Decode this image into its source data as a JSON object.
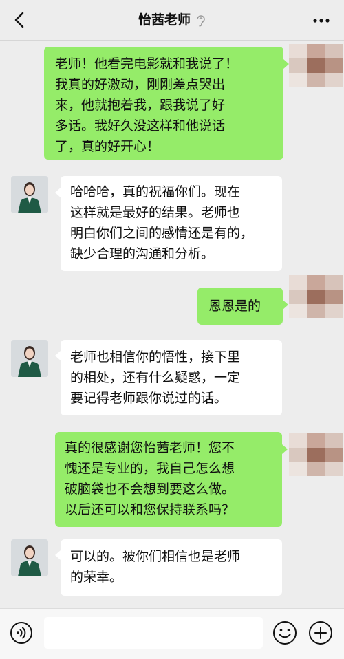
{
  "header": {
    "title": "怡茜老师"
  },
  "icons": {
    "back": "chevron-left-icon",
    "ear": "ear-icon",
    "more": "more-dots-icon",
    "voice": "voice-icon",
    "emoji": "emoji-icon",
    "plus": "plus-icon"
  },
  "colors": {
    "sent_bubble": "#95ec69",
    "received_bubble": "#ffffff",
    "background": "#ededed"
  },
  "messages": [
    {
      "from": "me",
      "text": "老师！他看完电影就和我说了！\n我真的好激动，刚刚差点哭出\n来，他就抱着我，跟我说了好\n多话。我好久没这样和他说话\n了，真的好开心！"
    },
    {
      "from": "teacher",
      "text": "哈哈哈，真的祝福你们。现在\n这样就是最好的结果。老师也\n明白你们之间的感情还是有的，\n缺少合理的沟通和分析。"
    },
    {
      "from": "me",
      "text": "恩恩是的"
    },
    {
      "from": "teacher",
      "text": "老师也相信你的悟性，接下里\n的相处，还有什么疑惑，一定\n要记得老师跟你说过的话。"
    },
    {
      "from": "me",
      "text": "真的很感谢您怡茜老师！您不\n愧还是专业的，我自己怎么想\n破脑袋也不会想到要这么做。\n以后还可以和您保持联系吗？"
    },
    {
      "from": "teacher",
      "text": "可以的。被你们相信也是老师\n的荣幸。"
    }
  ],
  "input": {
    "value": "",
    "placeholder": ""
  }
}
